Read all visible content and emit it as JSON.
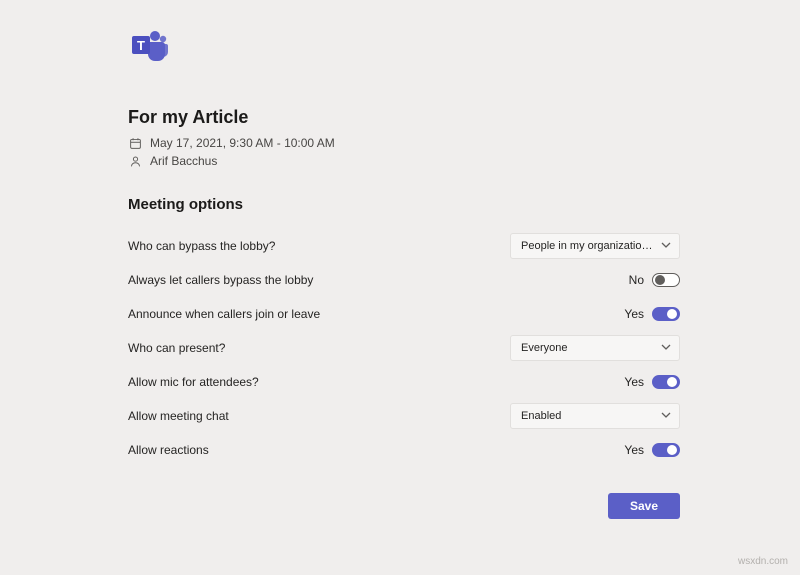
{
  "meeting": {
    "title": "For my Article",
    "datetime": "May 17, 2021, 9:30 AM - 10:00 AM",
    "organizer": "Arif Bacchus"
  },
  "sectionTitle": "Meeting options",
  "options": {
    "bypassLobby": {
      "label": "Who can bypass the lobby?",
      "value": "People in my organization and gu..."
    },
    "callersBypass": {
      "label": "Always let callers bypass the lobby",
      "stateText": "No"
    },
    "announceCallers": {
      "label": "Announce when callers join or leave",
      "stateText": "Yes"
    },
    "whoCanPresent": {
      "label": "Who can present?",
      "value": "Everyone"
    },
    "allowMic": {
      "label": "Allow mic for attendees?",
      "stateText": "Yes"
    },
    "allowChat": {
      "label": "Allow meeting chat",
      "value": "Enabled"
    },
    "allowReactions": {
      "label": "Allow reactions",
      "stateText": "Yes"
    }
  },
  "buttons": {
    "save": "Save"
  },
  "watermark": "wsxdn.com",
  "colors": {
    "accent": "#5b5fc7"
  }
}
